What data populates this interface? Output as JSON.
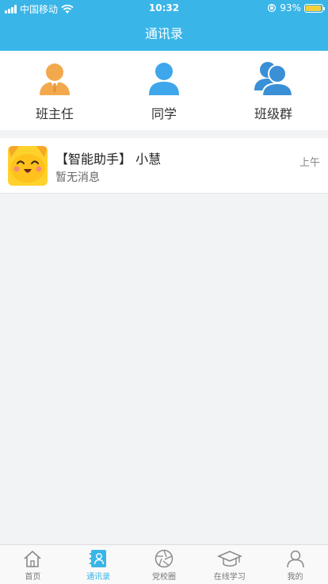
{
  "status_bar": {
    "carrier": "中国移动",
    "time": "10:32",
    "battery_percent": "93%"
  },
  "nav": {
    "title": "通讯录"
  },
  "categories": [
    {
      "label": "班主任",
      "icon": "teacher-icon",
      "color": "#f2a94e"
    },
    {
      "label": "同学",
      "icon": "classmate-icon",
      "color": "#3ea6ea"
    },
    {
      "label": "班级群",
      "icon": "class-group-icon",
      "color": "#3a8fd6"
    }
  ],
  "messages": [
    {
      "title": "【智能助手】 小慧",
      "preview": "暂无消息",
      "time": "上午",
      "avatar_icon": "assistant-avatar-icon"
    }
  ],
  "tabs": [
    {
      "label": "首页",
      "icon": "home-icon",
      "active": false
    },
    {
      "label": "通讯录",
      "icon": "contacts-icon",
      "active": true
    },
    {
      "label": "党校圈",
      "icon": "aperture-icon",
      "active": false
    },
    {
      "label": "在线学习",
      "icon": "graduation-cap-icon",
      "active": false
    },
    {
      "label": "我的",
      "icon": "profile-icon",
      "active": false
    }
  ],
  "colors": {
    "accent": "#39b5e8",
    "background": "#f2f3f5"
  }
}
